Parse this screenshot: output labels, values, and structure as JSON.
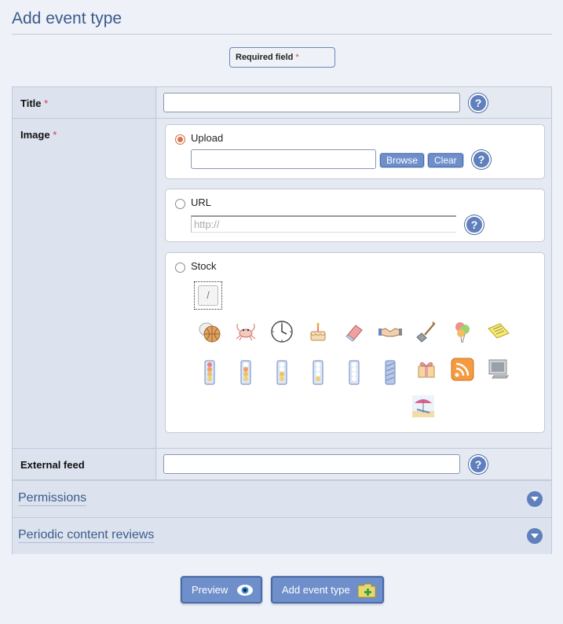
{
  "header": {
    "title": "Add event type"
  },
  "required_note": {
    "label": "Required field",
    "marker": "*"
  },
  "fields": {
    "title": {
      "label": "Title",
      "required_marker": "*",
      "value": "",
      "help": "?"
    },
    "image": {
      "label": "Image",
      "required_marker": "*",
      "upload": {
        "label": "Upload",
        "selected": true,
        "value": "",
        "browse": "Browse",
        "clear": "Clear",
        "help": "?"
      },
      "url": {
        "label": "URL",
        "selected": false,
        "placeholder": "http://",
        "help": "?"
      },
      "stock": {
        "label": "Stock",
        "selected": false,
        "selected_thumb": "/",
        "icons": [
          "basketball-icon",
          "crab-icon",
          "clock-icon",
          "birthday-cake-icon",
          "eraser-icon",
          "handshake-icon",
          "shovel-icon",
          "balloons-icon",
          "sticky-note-icon",
          "traffic-light-red-icon",
          "traffic-light-orange-icon",
          "traffic-light-yellow-icon",
          "traffic-light-blue-icon",
          "traffic-light-white-icon",
          "progress-bar-icon",
          "gift-box-icon",
          "rss-feed-icon",
          "monitor-icon",
          "beach-icon"
        ]
      }
    },
    "external_feed": {
      "label": "External feed",
      "value": "",
      "help": "?"
    }
  },
  "sections": [
    {
      "title": "Permissions"
    },
    {
      "title": "Periodic content reviews"
    }
  ],
  "actions": {
    "preview": "Preview",
    "submit": "Add event type"
  },
  "colors": {
    "accent": "#5f80bd",
    "title": "#3a5a8c",
    "required": "#d04040",
    "background": "#eef1f7"
  }
}
